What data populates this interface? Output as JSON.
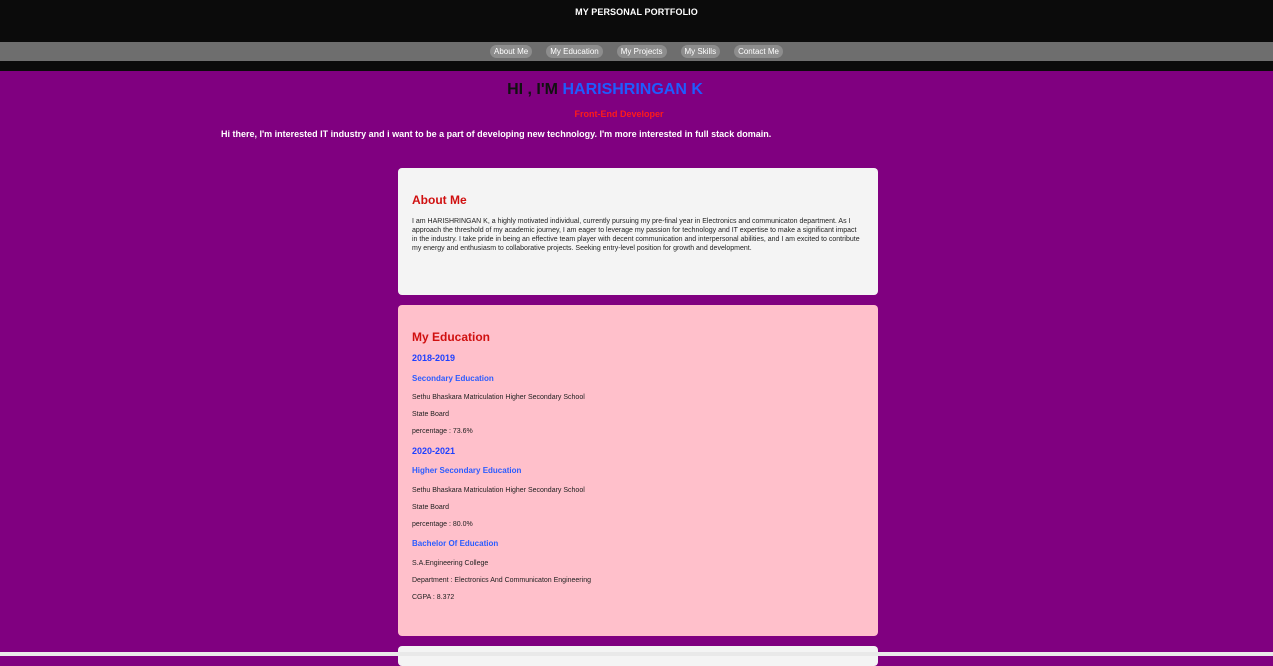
{
  "header": {
    "title": "MY PERSONAL PORTFOLIO"
  },
  "nav": {
    "items": [
      "About Me",
      "My Education",
      "My Projects",
      "My Skills",
      "Contact Me"
    ]
  },
  "hero": {
    "greeting": "HI , I'M",
    "name": "HARISHRINGAN K",
    "role": "Front-End Developer",
    "intro": "Hi there, I'm interested IT industry and i want to be a part of developing new technology. I'm more interested in full stack domain."
  },
  "about": {
    "title": "About Me",
    "text": "I am HARISHRINGAN K, a highly motivated individual, currently pursuing my pre-final year in Electronics and communicaton department. As I approach the threshold of my academic journey, I am eager to leverage my passion for technology and IT expertise to make a significant impact in the industry. I take pride in being an effective team player with decent communication and interpersonal abilities, and I am excited to contribute my energy and enthusiasm to collaborative projects. Seeking entry-level position for growth and development."
  },
  "education": {
    "title": "My Education",
    "entries": [
      {
        "year": "2018-2019",
        "degree": "Secondary Education",
        "school": "Sethu Bhaskara Matriculation Higher Secondary School",
        "board": "State Board",
        "score": "percentage : 73.6%"
      },
      {
        "year": "2020-2021",
        "degree": "Higher Secondary Education",
        "school": "Sethu Bhaskara Matriculation Higher Secondary School",
        "board": "State Board",
        "score": "percentage : 80.0%"
      },
      {
        "degree": "Bachelor Of Education",
        "school": "S.A.Engineering College",
        "department": "Department : Electronics And Communicaton Engineering",
        "score": "CGPA : 8.372"
      }
    ]
  },
  "colors": {
    "page_background": "#800080",
    "header_background": "#0b0b0b",
    "nav_background": "#6e6e6e",
    "accent_name": "#1e5cff",
    "accent_role": "#ff1a1a",
    "section_title": "#d01010",
    "about_card": "#f4f4f4",
    "education_card": "#ffc0cb"
  }
}
